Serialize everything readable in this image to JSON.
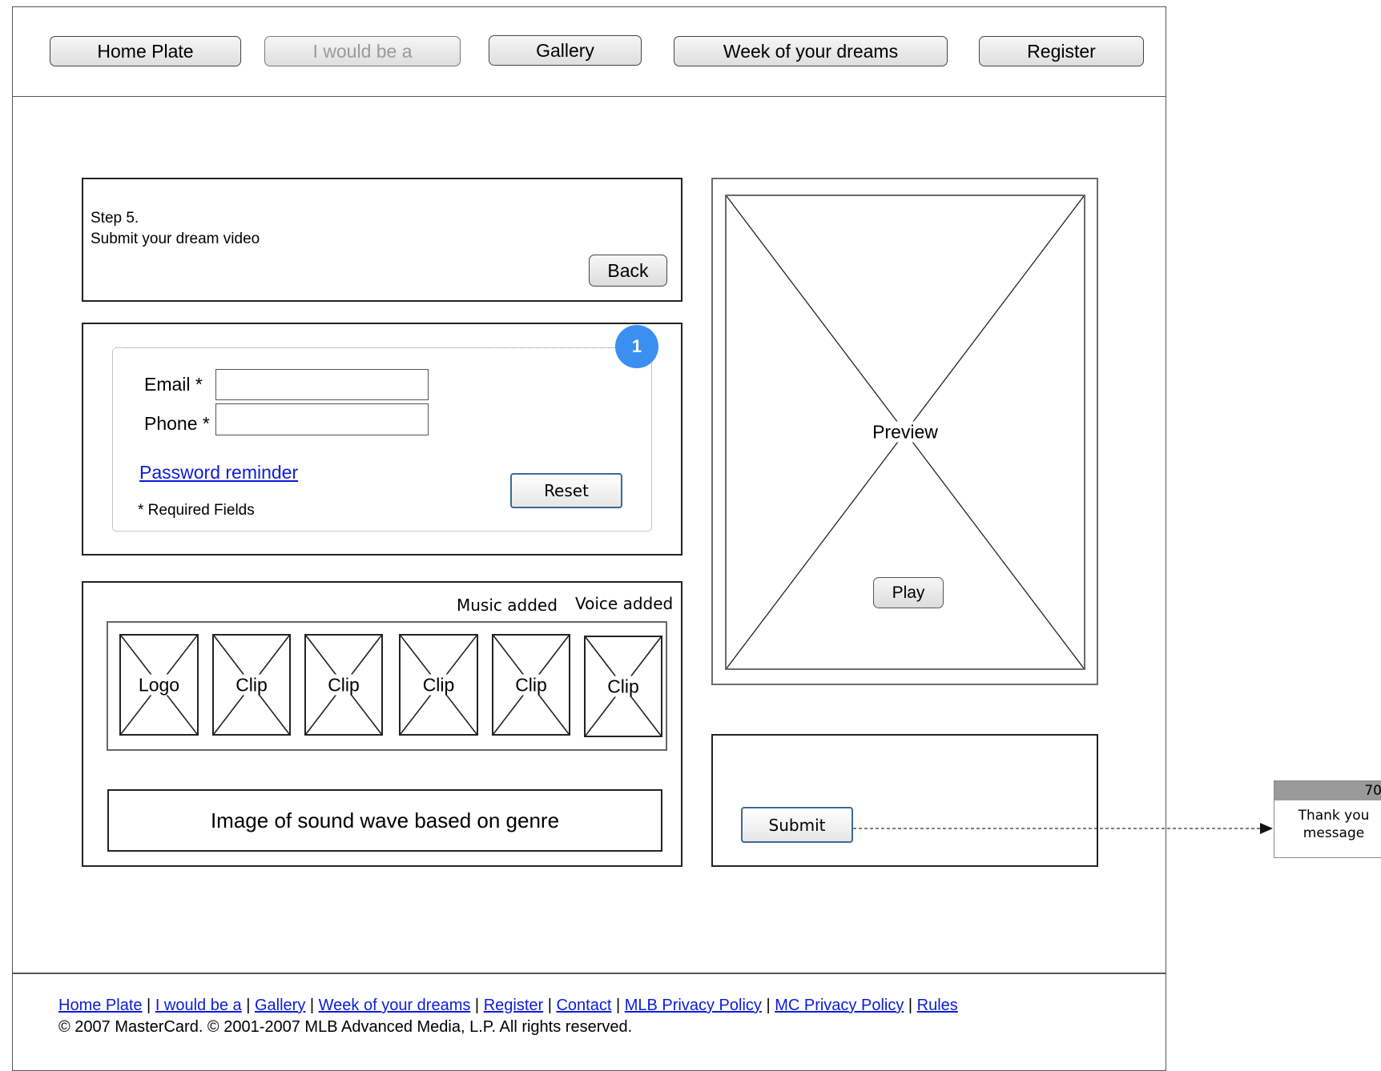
{
  "nav": {
    "items": [
      {
        "label": "Home Plate",
        "disabled": false
      },
      {
        "label": "I would be a",
        "disabled": true
      },
      {
        "label": "Gallery",
        "disabled": false
      },
      {
        "label": "Week of your dreams",
        "disabled": false
      },
      {
        "label": "Register",
        "disabled": false
      }
    ]
  },
  "step": {
    "number": "Step 5.",
    "title": "Submit your dream video",
    "back_label": "Back"
  },
  "form": {
    "marker": "1",
    "email_label": "Email *",
    "email_value": "",
    "phone_label": "Phone *",
    "phone_value": "",
    "password_reminder": "Password reminder",
    "reset_label": "Reset",
    "required_note": "* Required Fields"
  },
  "timeline": {
    "music_added": "Music added",
    "voice_added": "Voice added",
    "clips": [
      "Logo",
      "Clip",
      "Clip",
      "Clip",
      "Clip",
      "Clip"
    ],
    "soundwave_label": "Image of sound wave based on genre"
  },
  "preview": {
    "label": "Preview",
    "play_label": "Play"
  },
  "submit": {
    "label": "Submit"
  },
  "flow_target": {
    "number": "70",
    "text": "Thank you message"
  },
  "footer": {
    "links": [
      "Home Plate",
      "I would be a",
      "Gallery",
      "Week of your dreams",
      "Register",
      "Contact",
      "MLB Privacy Policy",
      "MC Privacy Policy",
      "Rules"
    ],
    "copyright": "© 2007 MasterCard. © 2001-2007 MLB Advanced Media, L.P. All rights reserved."
  }
}
